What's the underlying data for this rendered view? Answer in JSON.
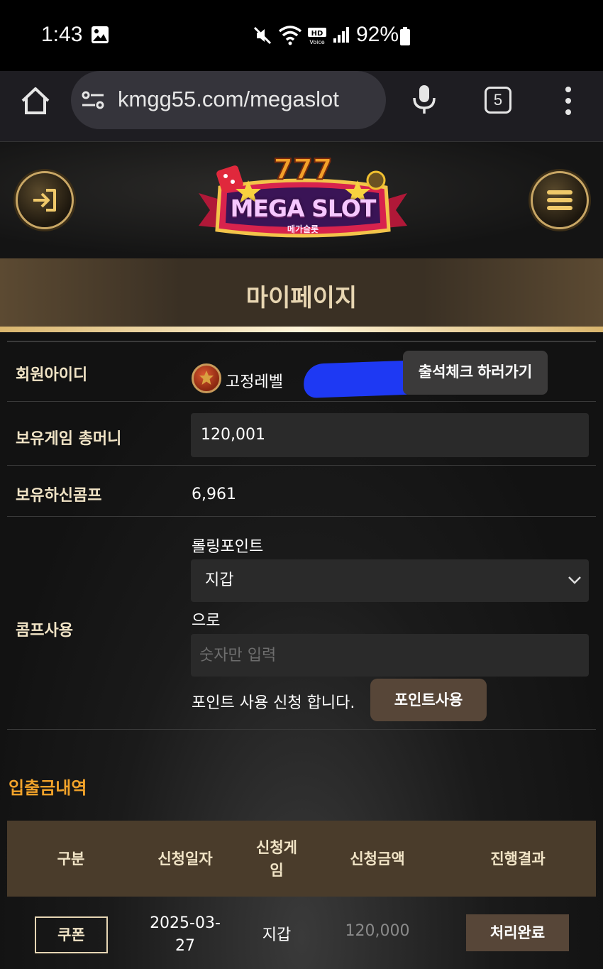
{
  "status_bar": {
    "time": "1:43",
    "battery": "92%",
    "icons": [
      "gallery-icon",
      "mute-icon",
      "wifi-icon",
      "hd-voice-icon",
      "signal-icon",
      "battery-icon"
    ]
  },
  "browser": {
    "url": "kmgg55.com/megaslot",
    "tab_count": "5",
    "icons": [
      "home-icon",
      "site-info-icon",
      "mic-icon",
      "more-icon"
    ]
  },
  "header": {
    "logo_text": "MEGA SLOT",
    "logo_sub": "메가슬롯",
    "icons": [
      "login-icon",
      "menu-icon"
    ]
  },
  "page": {
    "title": "마이페이지"
  },
  "profile": {
    "member_id_label": "회원아이디",
    "level_text": "고정레벨",
    "attendance_button": "출석체크 하러가기",
    "total_money_label": "보유게임 총머니",
    "total_money_value": "120,001",
    "comp_label": "보유하신콤프",
    "comp_value": "6,961",
    "comp_use_label": "콤프사용",
    "rolling_point_label": "롤링포인트",
    "wallet_select_value": "지갑",
    "to_label": "으로",
    "amount_placeholder": "숫자만 입력",
    "point_note": "포인트 사용 신청 합니다.",
    "point_use_button": "포인트사용"
  },
  "history": {
    "title": "입출금내역",
    "columns": [
      "구분",
      "신청일자",
      "신청게\n임",
      "신청금액",
      "진행결과"
    ],
    "rows": [
      {
        "type": "쿠폰",
        "date": "2025-03-\n27",
        "game": "지갑",
        "amount": "120,000",
        "result": "처리완료"
      }
    ]
  },
  "colors": {
    "accent_gold": "#d9b56d",
    "section_title": "#f2a32a",
    "header_brown": "#4a3c2b",
    "button_brown": "#574638"
  }
}
